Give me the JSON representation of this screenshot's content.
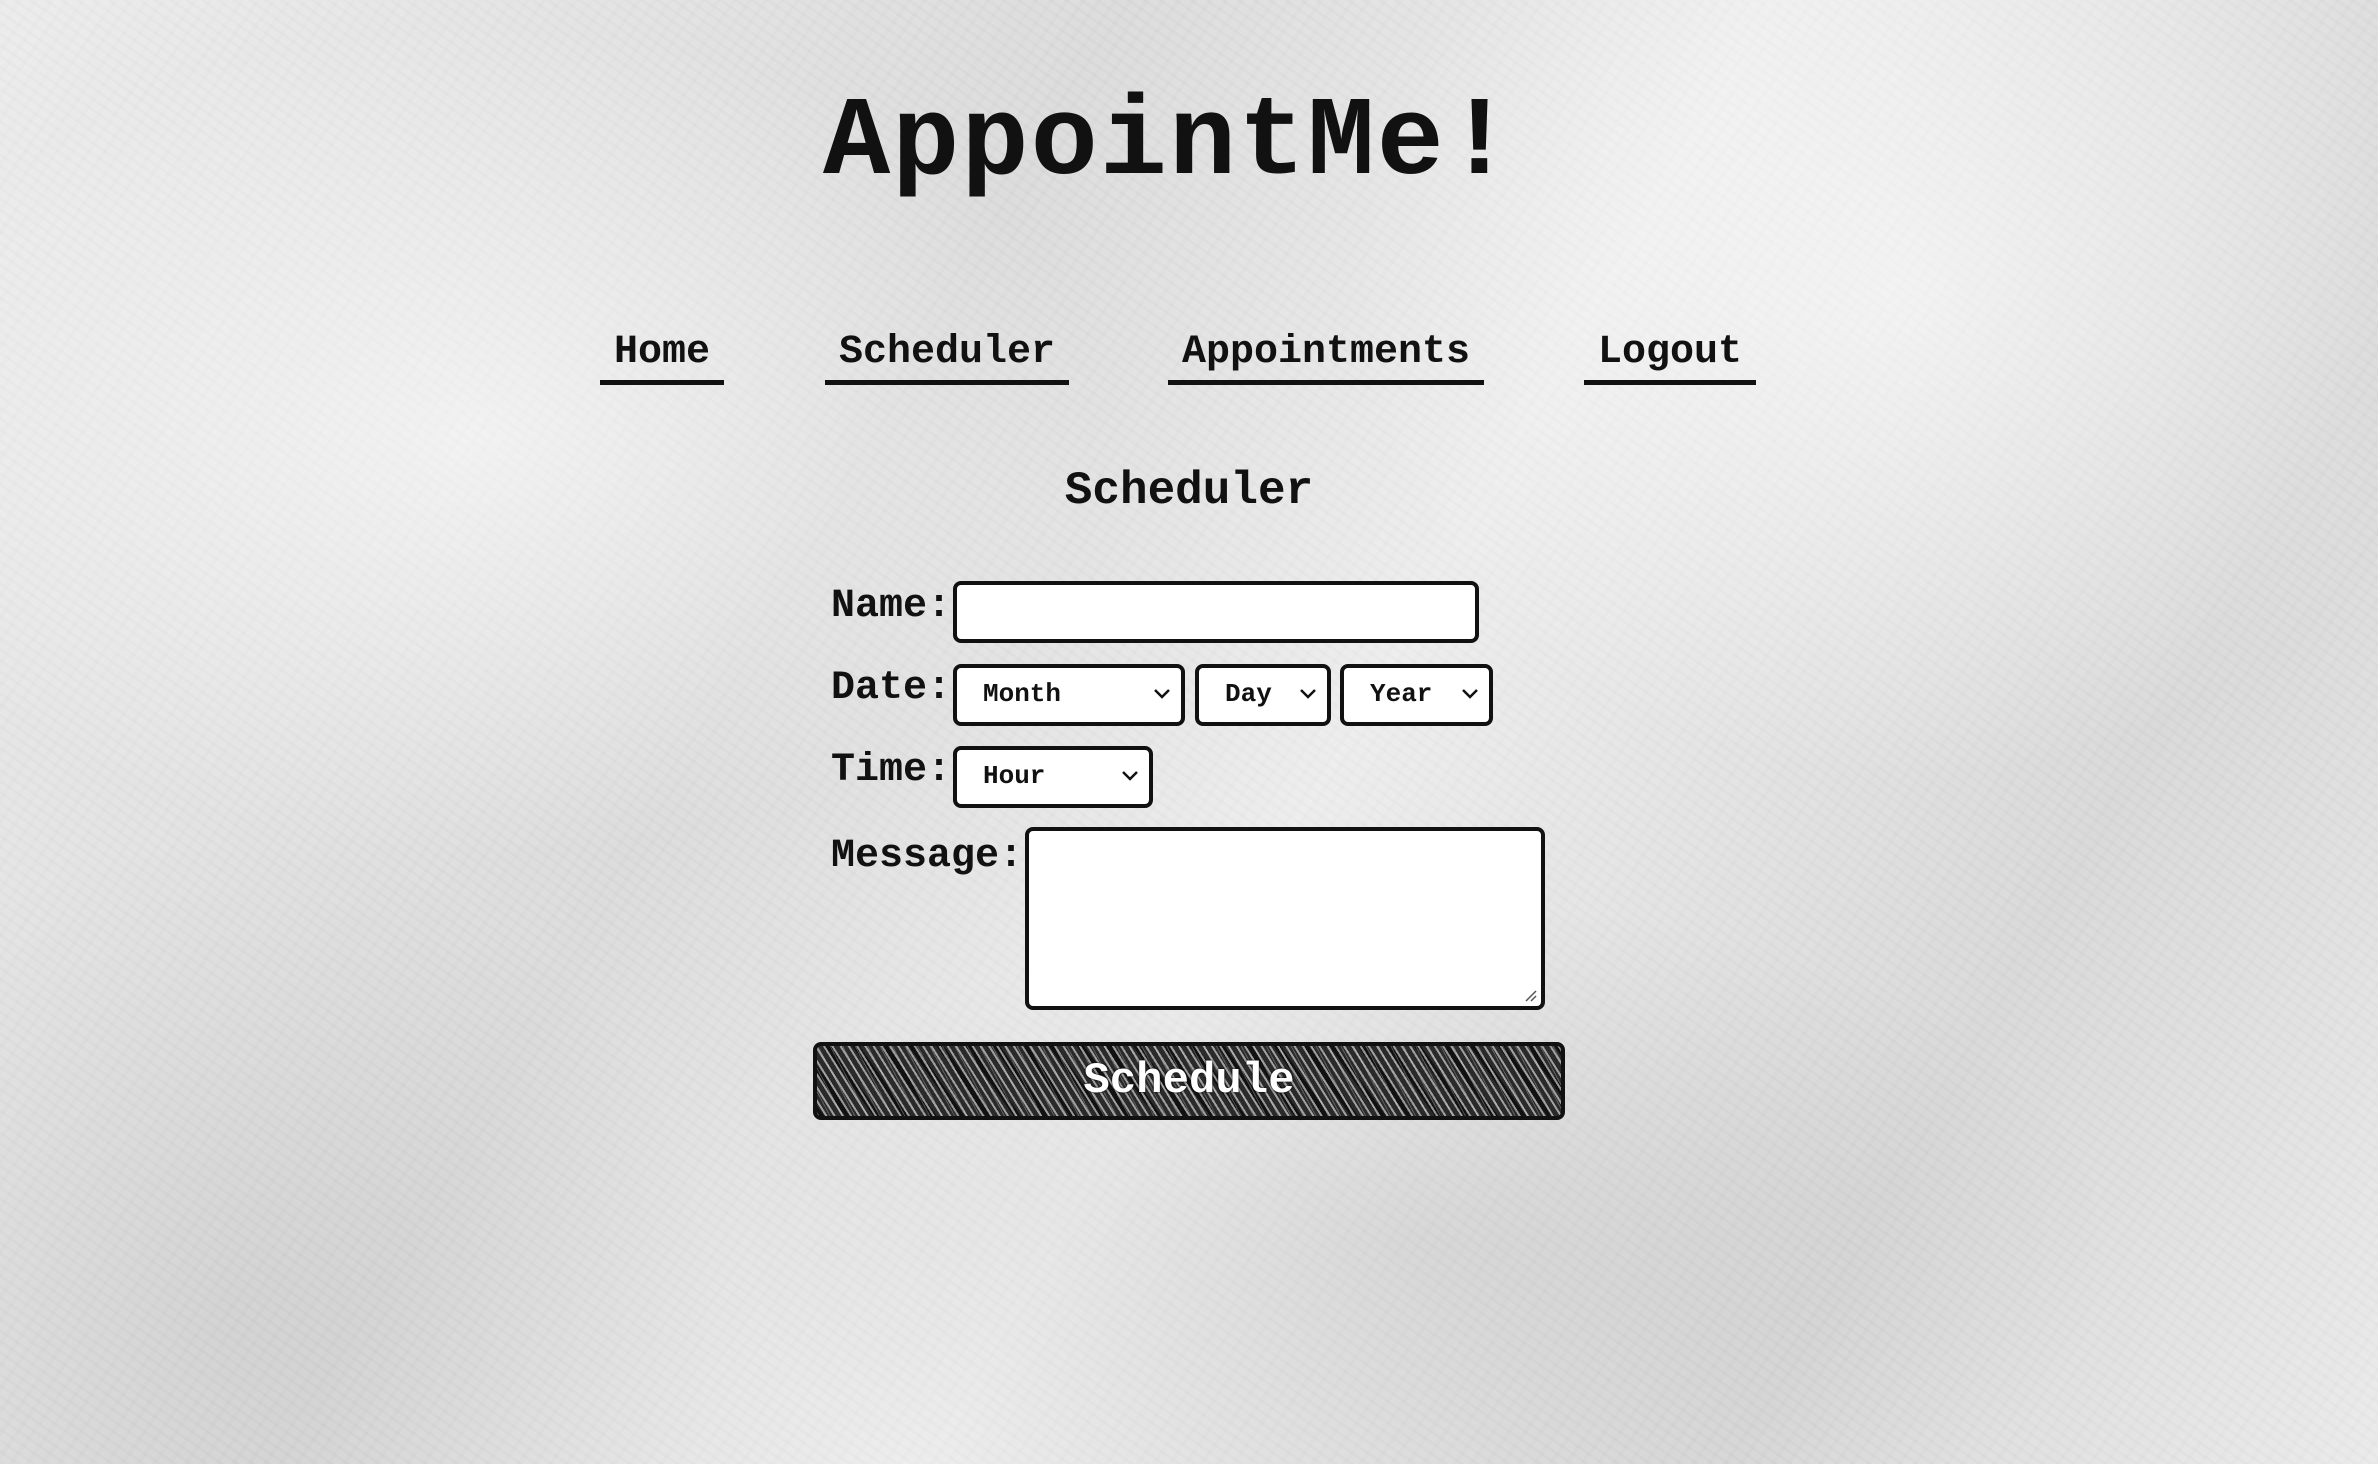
{
  "header": {
    "logo_text": "AppointMe!"
  },
  "nav": {
    "items": [
      {
        "label": "Home"
      },
      {
        "label": "Scheduler"
      },
      {
        "label": "Appointments"
      },
      {
        "label": "Logout"
      }
    ]
  },
  "page": {
    "heading": "Scheduler"
  },
  "form": {
    "name_label": "Name:",
    "name_value": "",
    "date_label": "Date:",
    "month_selected": "Month",
    "day_selected": "Day",
    "year_selected": "Year",
    "time_label": "Time:",
    "hour_selected": "Hour",
    "message_label": "Message:",
    "message_value": "",
    "submit_label": "Schedule"
  },
  "icons": {
    "select_arrow": "chevron-down-icon",
    "textarea_resize": "resize-grip-icon"
  },
  "colors": {
    "ink": "#111111",
    "field_background": "#ffffff",
    "paper": "#e6e6e6"
  }
}
